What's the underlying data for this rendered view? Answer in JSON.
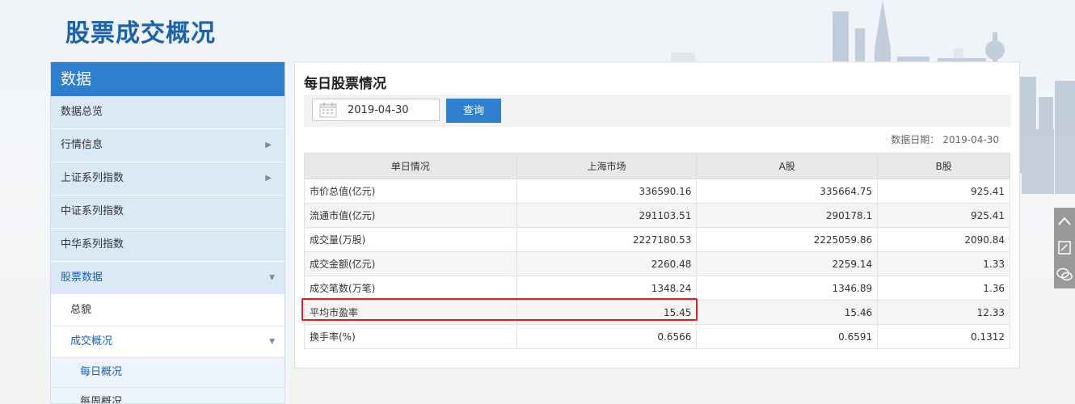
{
  "page": {
    "title": "股票成交概况"
  },
  "sidebar": {
    "header": "数据",
    "items": [
      {
        "label": "数据总览",
        "has_children": false
      },
      {
        "label": "行情信息",
        "has_children": true
      },
      {
        "label": "上证系列指数",
        "has_children": true
      },
      {
        "label": "中证系列指数",
        "has_children": false
      },
      {
        "label": "中华系列指数",
        "has_children": false
      },
      {
        "label": "股票数据",
        "expanded": true
      }
    ],
    "sub_items": [
      {
        "label": "总貌"
      },
      {
        "label": "成交概况",
        "expanded": true
      }
    ],
    "sub_sub_items": [
      {
        "label": "每日概况",
        "active": true
      },
      {
        "label": "每周概况"
      }
    ]
  },
  "panel": {
    "title": "每日股票情况",
    "date_value": "2019-04-30",
    "query_label": "查询",
    "data_date_label": "数据日期：",
    "data_date_value": "2019-04-30"
  },
  "table": {
    "headers": [
      "单日情况",
      "上海市场",
      "A股",
      "B股"
    ],
    "rows": [
      [
        "市价总值(亿元)",
        "336590.16",
        "335664.75",
        "925.41"
      ],
      [
        "流通市值(亿元)",
        "291103.51",
        "290178.1",
        "925.41"
      ],
      [
        "成交量(万股)",
        "2227180.53",
        "2225059.86",
        "2090.84"
      ],
      [
        "成交金额(亿元)",
        "2260.48",
        "2259.14",
        "1.33"
      ],
      [
        "成交笔数(万笔)",
        "1348.24",
        "1346.89",
        "1.36"
      ],
      [
        "平均市盈率",
        "15.45",
        "15.46",
        "12.33"
      ],
      [
        "换手率(%)",
        "0.6566",
        "0.6591",
        "0.1312"
      ]
    ]
  },
  "colors": {
    "accent": "#2f7fcf",
    "title": "#1d62a8",
    "highlight": "#e02020"
  },
  "side_tools": [
    "chevron-up-icon",
    "edit-icon",
    "wechat-icon"
  ]
}
